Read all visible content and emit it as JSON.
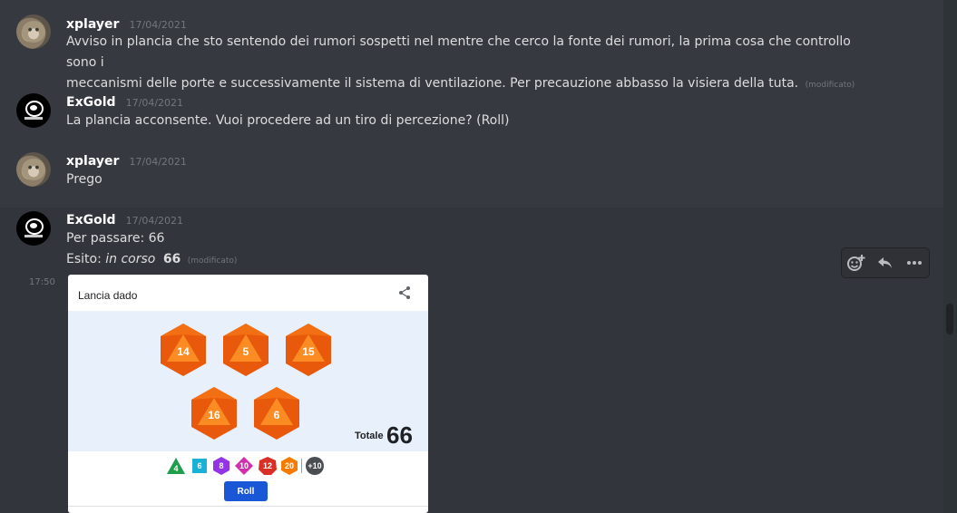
{
  "messages": [
    {
      "username": "xplayer",
      "timestamp": "17/04/2021",
      "text": "Avviso in plancia che sto sentendo dei rumori sospetti nel mentre che cerco la fonte dei rumori, la prima cosa che controllo sono i",
      "text2": "meccanismi delle porte e successivamente il sistema di ventilazione. Per precauzione abbasso la visiera della tuta.",
      "edited": "(modificato)"
    },
    {
      "username": "ExGold",
      "timestamp": "17/04/2021",
      "text": "La plancia acconsente. Vuoi procedere ad un tiro di percezione? (Roll)"
    },
    {
      "username": "xplayer",
      "timestamp": "17/04/2021",
      "text": "Prego"
    },
    {
      "username": "ExGold",
      "timestamp": "17/04/2021",
      "text": "Per passare: 66",
      "esito_prefix": "Esito:",
      "esito_status": "in corso",
      "esito_value": "66",
      "edited": "(modificato)"
    }
  ],
  "side_timestamp": "17:50",
  "toolbar": {
    "icons": [
      "add-reaction-icon",
      "reply-icon",
      "more-icon"
    ]
  },
  "dice_card": {
    "title": "Lancia dado",
    "dice": [
      "14",
      "5",
      "15",
      "16",
      "6"
    ],
    "total_label": "Totale",
    "total_value": "66",
    "dice_types": [
      "4",
      "6",
      "8",
      "10",
      "12",
      "20",
      "+10"
    ],
    "roll_label": "Roll",
    "colors": {
      "d4": "#1e9e4a",
      "d6": "#1ab1d6",
      "d8": "#9334e6",
      "d10": "#d12fb0",
      "d12": "#d93025",
      "d20": "#f57c00",
      "plus": "#5f6368",
      "die": "#f25c05"
    }
  }
}
